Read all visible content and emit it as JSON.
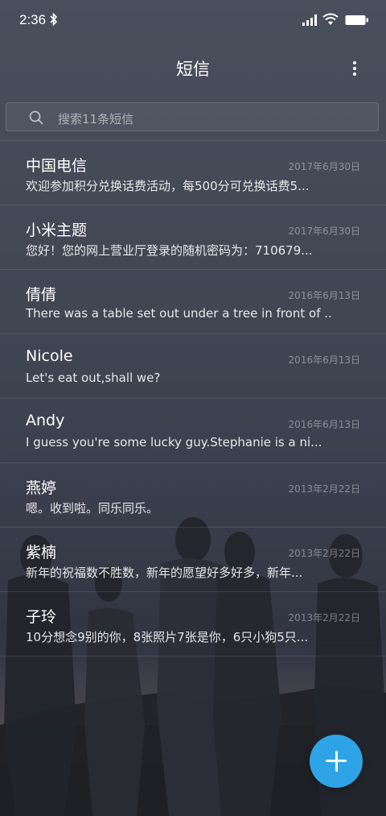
{
  "status_bar": {
    "time": "2:36"
  },
  "header": {
    "title": "短信"
  },
  "search": {
    "placeholder": "搜索11条短信"
  },
  "messages": [
    {
      "name": "中国电信",
      "date": "2017年6月30日",
      "preview": "欢迎参加积分兑换话费活动，每500分可兑换话费5..."
    },
    {
      "name": "小米主题",
      "date": "2017年6月30日",
      "preview": "您好！您的网上营业厅登录的随机密码为：710679..."
    },
    {
      "name": "倩倩",
      "date": "2016年6月13日",
      "preview": "There was a table set out under a tree in front of ..."
    },
    {
      "name": "Nicole",
      "date": "2016年6月13日",
      "preview": "Let's eat out,shall we?"
    },
    {
      "name": "Andy",
      "date": "2016年6月13日",
      "preview": "I guess you're some lucky guy.Stephanie is a ni..."
    },
    {
      "name": "燕婷",
      "date": "2013年2月22日",
      "preview": "嗯。收到啦。同乐同乐。"
    },
    {
      "name": "紫楠",
      "date": "2013年2月22日",
      "preview": "新年的祝福数不胜数，新年的愿望好多好多，新年..."
    },
    {
      "name": "子玲",
      "date": "2013年2月22日",
      "preview": "10分想念9别的你，8张照片7张是你，6只小狗5只..."
    }
  ],
  "icons": {
    "bluetooth": "bluetooth-icon",
    "signal": "signal-icon",
    "wifi": "wifi-icon",
    "battery": "battery-icon",
    "more": "more-vertical-icon",
    "search": "search-icon",
    "fab": "plus-icon"
  },
  "colors": {
    "accent": "#2ea4e6"
  }
}
